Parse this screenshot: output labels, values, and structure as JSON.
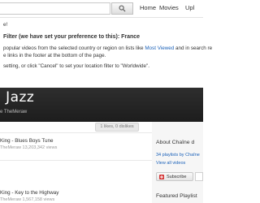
{
  "header": {
    "search_button_icon": "search-icon",
    "nav": [
      "Home",
      "Movies",
      "Upl"
    ]
  },
  "notice": {
    "line1": "e!",
    "line2": "Filter (we have set your preference to this): France",
    "line3_a": "popular videos from the selected country or region on lists like ",
    "line3_link": "Most Viewed",
    "line3_b": " and in search re",
    "line4": "e links in the footer at the bottom of the page.",
    "line5": "setting, or click \"Cancel\" to set your location filter to \"Worldwide\"."
  },
  "channel": {
    "title": "' Jazz",
    "byline": "e TheMeraw"
  },
  "stats": "1 likes, 0 dislikes",
  "videos": [
    {
      "title": "King - Blues Boys Tune",
      "meta": "TheMeraw  13,203,342 views"
    },
    {
      "title": "King - Key to the Highway",
      "meta": "TheMeraw  1,567,158 views"
    }
  ],
  "sidebar": {
    "about_header": "About Chaîne d",
    "playlists_link": "34 playlists by Chaîne",
    "all_videos_link": "View all videos",
    "subscribe_label": "Subscribe",
    "featured_header": "Featured Playlist"
  }
}
